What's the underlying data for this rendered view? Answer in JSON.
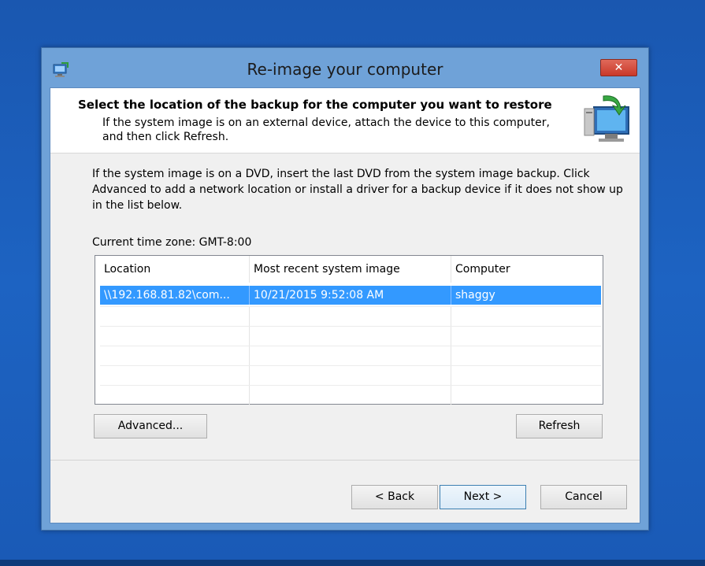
{
  "window": {
    "title": "Re-image your computer",
    "close_label": "✕"
  },
  "header": {
    "title": "Select the location of the backup for the computer you want to restore",
    "description": "If the system image is on an external device, attach the device to this computer, and then click Refresh."
  },
  "intro_text": "If the system image is on a DVD, insert the last DVD from the system image backup. Click Advanced to add a network location or install a driver for a backup device if it does not show up in the list below.",
  "timezone_label": "Current time zone: GMT-8:00",
  "list": {
    "columns": [
      "Location",
      "Most recent system image",
      "Computer"
    ],
    "rows": [
      {
        "location": "\\\\192.168.81.82\\com...",
        "image_date": "10/21/2015 9:52:08 AM",
        "computer": "shaggy",
        "selected": true
      }
    ]
  },
  "buttons": {
    "advanced": "Advanced...",
    "refresh": "Refresh",
    "back": "< Back",
    "next": "Next >",
    "cancel": "Cancel"
  },
  "colors": {
    "desktop": "#1c5cb8",
    "window_frame": "#6fa2d8",
    "selection": "#3399ff",
    "close_button": "#c9392a"
  },
  "icons": {
    "app": "restore-computer-icon",
    "header": "monitor-restore-icon",
    "close": "close-icon"
  }
}
